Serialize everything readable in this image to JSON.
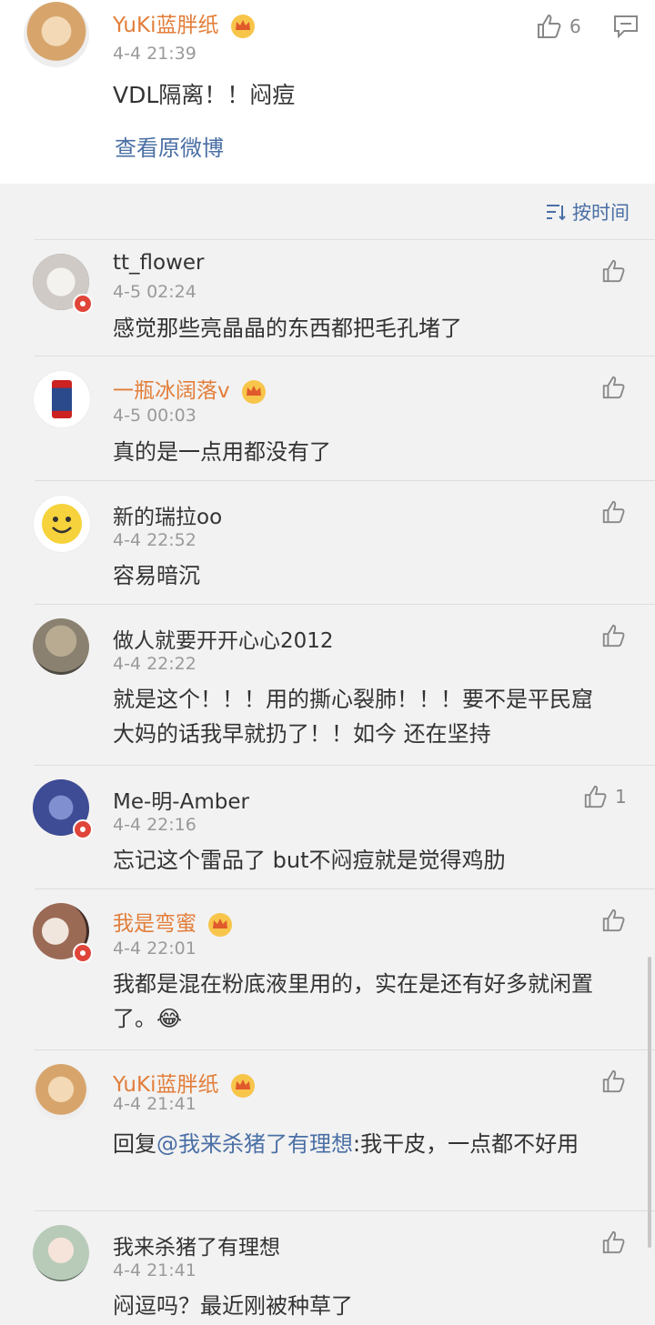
{
  "post": {
    "name": "YuKi蓝胖纸",
    "time": "4-4 21:39",
    "text": "VDL隔离！！闷痘",
    "like_count": "6",
    "view_original": "查看原微博"
  },
  "sort": {
    "label": "按时间"
  },
  "comments": [
    {
      "name": "tt_flower",
      "vip": false,
      "time": "4-5 02:24",
      "text": "感觉那些亮晶晶的东西都把毛孔堵了",
      "likes": "",
      "avatar_color": "#cfcac5"
    },
    {
      "name": "一瓶冰阔落v",
      "vip": true,
      "time": "4-5 00:03",
      "text": "真的是一点用都没有了",
      "likes": "",
      "avatar_color": "#2a4a8c"
    },
    {
      "name": "新的瑞拉oo",
      "vip": false,
      "time": "4-4 22:52",
      "text": "容易暗沉",
      "likes": "",
      "avatar_color": "#f6d23c"
    },
    {
      "name": "做人就要开开心心2012",
      "vip": false,
      "time": "4-4 22:22",
      "text": "就是这个！！！用的撕心裂肺！！！要不是平民窟大妈的话我早就扔了！！如今 还在坚持",
      "likes": "",
      "avatar_color": "#8a8170"
    },
    {
      "name": "Me-明-Amber",
      "vip": false,
      "time": "4-4 22:16",
      "text": "忘记这个雷品了 but不闷痘就是觉得鸡肋",
      "likes": "1",
      "avatar_color": "#3e4c96"
    },
    {
      "name": "我是弯蜜",
      "vip": true,
      "time": "4-4 22:01",
      "text": "我都是混在粉底液里用的，实在是还有好多就闲置了。😂",
      "likes": "",
      "avatar_color": "#9a6a55"
    },
    {
      "name": "YuKi蓝胖纸",
      "vip": true,
      "time": "4-4 21:41",
      "text_prefix": "回复",
      "mention": "@我来杀猪了有理想",
      "text_suffix": ":我干皮，一点都不好用",
      "likes": "",
      "avatar_color": "#d7b58f"
    },
    {
      "name": "我来杀猪了有理想",
      "vip": false,
      "time": "4-4 21:41",
      "text": "闷逗吗？最近刚被种草了",
      "likes": "",
      "avatar_color": "#b8cbb9"
    }
  ],
  "colors": {
    "vip_name": "#e27e3a",
    "link": "#4a6fa5",
    "background": "#f2f2f2"
  },
  "icons": [
    "thumb-up-icon",
    "comment-icon",
    "sort-icon",
    "crown-icon",
    "verified-badge-icon"
  ]
}
